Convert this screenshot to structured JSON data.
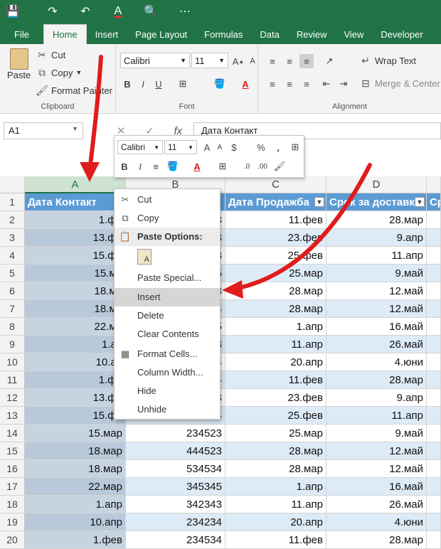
{
  "qat": {
    "save": "💾",
    "redo": "↷",
    "undo": "↶",
    "font_color": "A",
    "print_preview": "🔍",
    "more": "⋯"
  },
  "tabs": [
    "File",
    "Home",
    "Insert",
    "Page Layout",
    "Formulas",
    "Data",
    "Review",
    "View",
    "Developer"
  ],
  "ribbon": {
    "clipboard": {
      "paste": "Paste",
      "cut": "Cut",
      "copy": "Copy",
      "format_painter": "Format Painter",
      "label": "Clipboard"
    },
    "font": {
      "name": "Calibri",
      "size": "11",
      "label": "Font"
    },
    "alignment": {
      "wrap_text": "Wrap Text",
      "merge_center": "Merge & Center",
      "label": "Alignment"
    }
  },
  "formula_bar": {
    "name_box": "A1",
    "value": "Дата Контакт",
    "fx": "fx"
  },
  "mini_toolbar": {
    "font": "Calibri",
    "size": "11",
    "percent": "%",
    "comma": ","
  },
  "columns": [
    "A",
    "B",
    "C",
    "D"
  ],
  "header_row": [
    "Дата Контакт",
    "",
    "Дата Продажба",
    "Срок за доставка",
    "Ср"
  ],
  "rows": [
    [
      "1.фе",
      "3",
      "11.фев",
      "28.мар"
    ],
    [
      "13.фе",
      "3",
      "23.фев",
      "9.апр"
    ],
    [
      "15.фе",
      "3",
      "25.фев",
      "11.апр"
    ],
    [
      "15.ма",
      "5",
      "25.мар",
      "9.май"
    ],
    [
      "18.ма",
      "3",
      "28.мар",
      "12.май"
    ],
    [
      "18.ма",
      "4",
      "28.мар",
      "12.май"
    ],
    [
      "22.ма",
      "5",
      "1.апр",
      "16.май"
    ],
    [
      "1.ап",
      "3",
      "11.апр",
      "26.май"
    ],
    [
      "10.ап",
      "4",
      "20.апр",
      "4.юни"
    ],
    [
      "1.фе",
      "4",
      "11.фев",
      "28.мар"
    ],
    [
      "13.фе",
      "3",
      "23.фев",
      "9.апр"
    ],
    [
      "15.фе",
      "4",
      "25.фев",
      "11.апр"
    ],
    [
      "15.мар",
      "234523",
      "25.мар",
      "9.май"
    ],
    [
      "18.мар",
      "444523",
      "28.мар",
      "12.май"
    ],
    [
      "18.мар",
      "534534",
      "28.мар",
      "12.май"
    ],
    [
      "22.мар",
      "345345",
      "1.апр",
      "16.май"
    ],
    [
      "1.апр",
      "342343",
      "11.апр",
      "26.май"
    ],
    [
      "10.апр",
      "234234",
      "20.апр",
      "4.юни"
    ],
    [
      "1.фев",
      "234534",
      "11.фев",
      "28.мар"
    ]
  ],
  "row_numbers": [
    "1",
    "2",
    "3",
    "4",
    "5",
    "6",
    "7",
    "8",
    "9",
    "10",
    "11",
    "12",
    "13",
    "14",
    "15",
    "16",
    "17",
    "18",
    "19",
    "20"
  ],
  "context_menu": {
    "cut": "Cut",
    "copy": "Copy",
    "paste_options": "Paste Options:",
    "paste_special": "Paste Special...",
    "insert": "Insert",
    "delete": "Delete",
    "clear_contents": "Clear Contents",
    "format_cells": "Format Cells...",
    "column_width": "Column Width...",
    "hide": "Hide",
    "unhide": "Unhide"
  },
  "colors": {
    "excel_green": "#217346",
    "table_header": "#5b9bd5",
    "band": "#ddebf7",
    "arrow": "#e01c1c"
  }
}
